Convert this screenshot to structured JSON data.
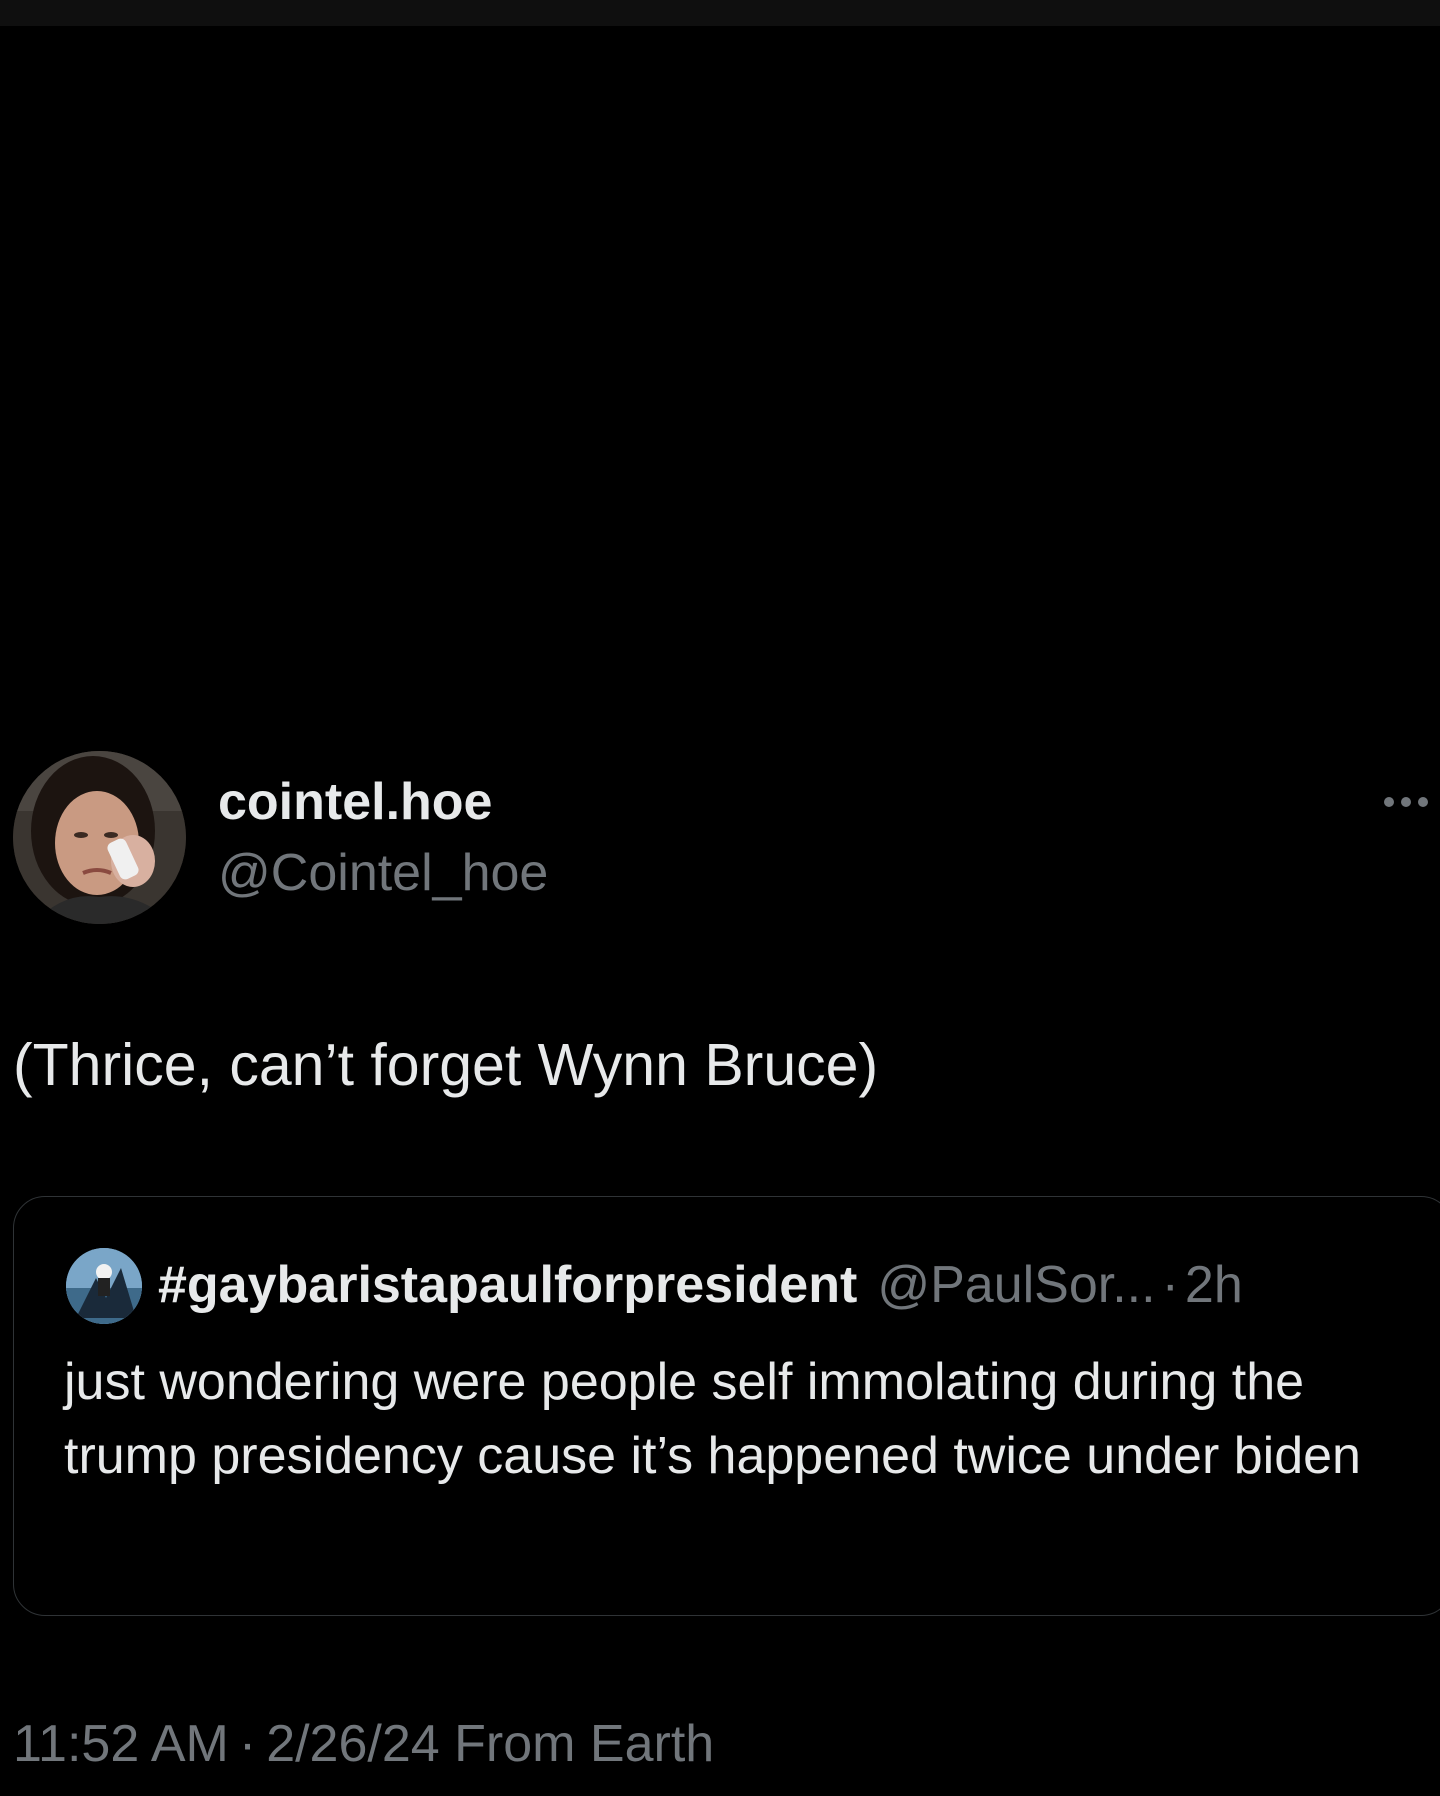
{
  "author": {
    "display_name": "cointel.hoe",
    "handle": "@Cointel_hoe"
  },
  "tweet": {
    "text": "(Thrice, can’t forget Wynn Bruce)"
  },
  "quoted_tweet": {
    "display_name": "#gaybaristapaulforpresident",
    "handle": "@PaulSor...",
    "separator": "·",
    "time": "2h",
    "text": "just wondering were people self immolating during the trump presidency cause it’s happened twice under biden"
  },
  "meta": {
    "time": "11:52 AM",
    "separator": "·",
    "date": "2/26/24",
    "source": "From Earth"
  },
  "colors": {
    "background": "#000000",
    "primary_text": "#e7e9ea",
    "secondary_text": "#71767b",
    "border": "#2f3336"
  },
  "icons": {
    "more": "more-horizontal-icon"
  }
}
